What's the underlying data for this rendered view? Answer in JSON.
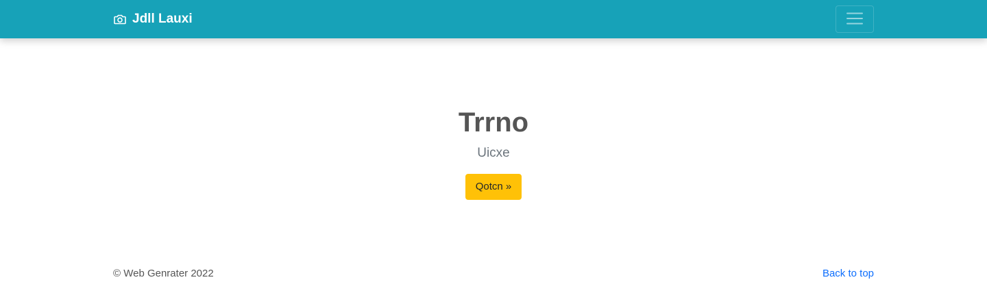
{
  "navbar": {
    "brand_label": "Jdll Lauxi",
    "brand_icon": "camera-icon",
    "toggler_icon": "hamburger-menu-icon",
    "background_color": "#17a2b8"
  },
  "hero": {
    "title": "Trrno",
    "subtitle": "Uicxe",
    "button_label": "Qotcn »",
    "button_color": "#ffc107"
  },
  "footer": {
    "copyright": "© Web Genrater 2022",
    "back_to_top": "Back to top",
    "link_color": "#0d6efd"
  }
}
